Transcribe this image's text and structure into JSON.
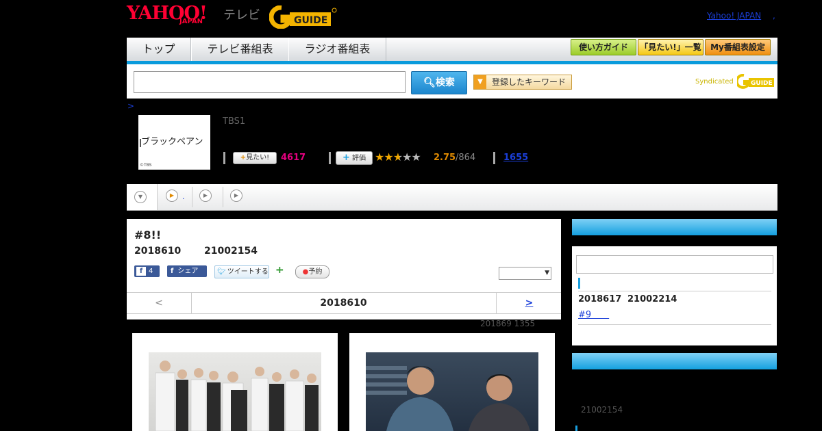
{
  "header": {
    "logo_yahoo": "YAHOO!",
    "logo_japan": "JAPAN",
    "logo_tv": "テレビ",
    "yahoo_japan_link": "Yahoo! JAPAN",
    "link_suffix": ","
  },
  "nav": {
    "tabs": [
      "トップ",
      "テレビ番組表",
      "ラジオ番組表"
    ],
    "buttons": [
      "使い方ガイド",
      "「見たい!」一覧",
      "My番組表設定"
    ]
  },
  "search": {
    "input_value": "",
    "button_label": "検索",
    "keyword_button": "登録したキーワード",
    "syndicated_label": "Syndicated"
  },
  "program": {
    "breadcrumb": ">",
    "thumbnail_title": "ブラックペアン",
    "thumbnail_credit": "©TBS",
    "channel": "TBS1",
    "mitai_label": "見たい!",
    "mitai_count": "4617",
    "hyoka_label": "評価",
    "rating": "2.75",
    "rating_total": "/864",
    "rating_value": 2.75,
    "review_count": "1655"
  },
  "tabs": {
    "tab2_text": "."
  },
  "episode": {
    "title": "#8!!",
    "date": "2018610",
    "time": "21002154",
    "fb_like_count": "4",
    "fb_share": "シェア",
    "tweet": "ツイートする",
    "reserve": "予約",
    "nav_prev": "<",
    "nav_date": "2018610",
    "nav_next": ">",
    "updated": "201869  1355"
  },
  "sidebar": {
    "next_date": "2018617",
    "next_time": "21002214",
    "next_episode": "#9　　",
    "second_time": "21002154"
  },
  "colors": {
    "accent": "#0a9bdc",
    "mitai": "#e4007f",
    "rating": "#e08a00",
    "link": "#1b3fd9"
  }
}
